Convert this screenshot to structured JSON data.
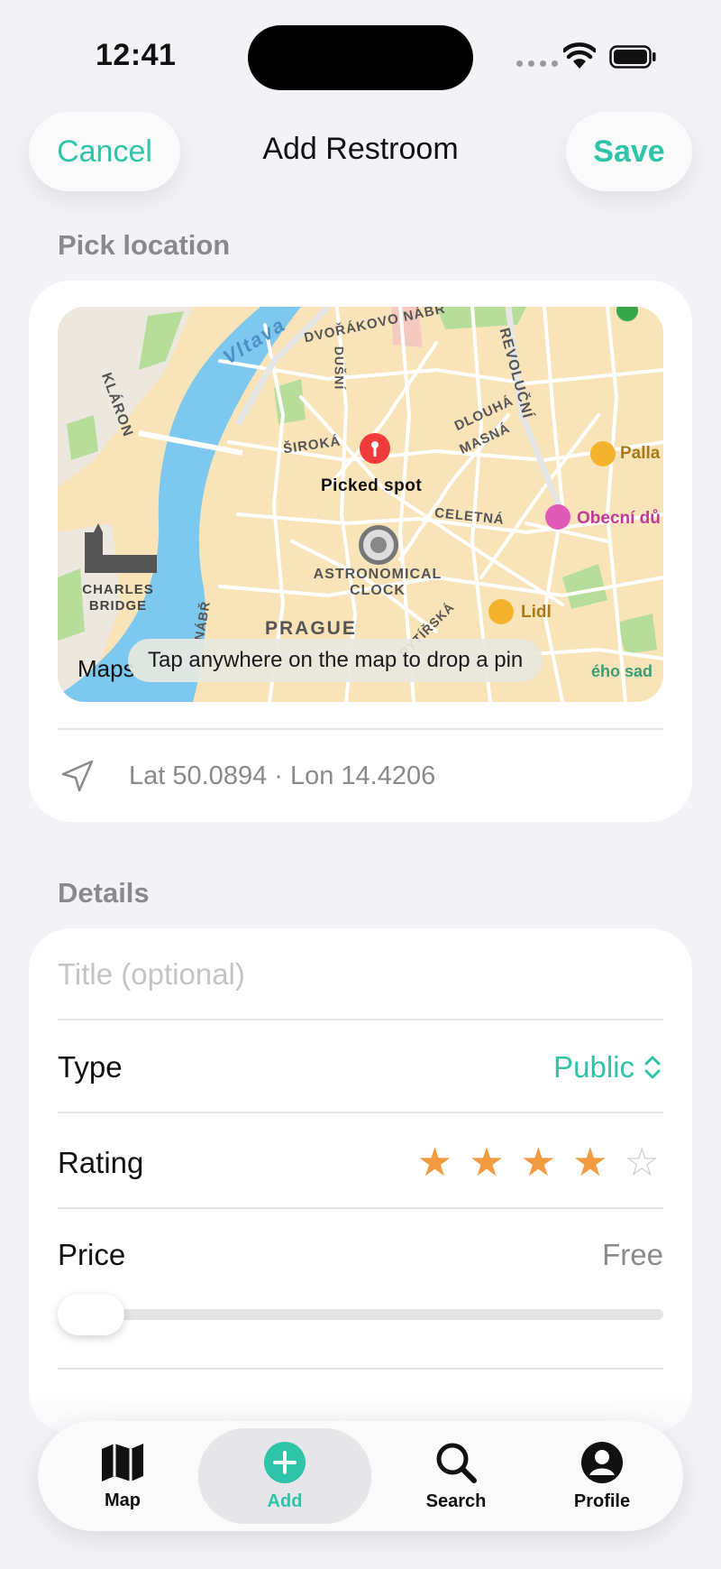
{
  "status": {
    "time": "12:41"
  },
  "nav": {
    "cancel": "Cancel",
    "title": "Add Restroom",
    "save": "Save"
  },
  "location": {
    "section_title": "Pick location",
    "map_labels": {
      "vltava": "Vltava",
      "dvorakovo": "DVOŘÁKOVO NÁBŘ",
      "klaron": "KLÁRON",
      "dusni": "DUŠNÍ",
      "revolucni": "REVOLUČNÍ",
      "dlouha": "DLOUHÁ",
      "masna": "MASNÁ",
      "siroka": "ŠIROKÁ",
      "celetna": "CELETNÁ",
      "astronomical_clock": "ASTRONOMICAL CLOCK",
      "charles_bridge": "CHARLES BRIDGE",
      "prague": "PRAGUE",
      "picked_spot": "Picked spot",
      "palla": "Palla",
      "obecni": "Obecní dů",
      "lidl": "Lidl",
      "kehosad": "ého sad",
      "nabr": "NÁBŘ",
      "rytirska": "RYTÍŘSKÁ",
      "maps_logo": "Maps"
    },
    "hint": "Tap anywhere on the map to drop a pin",
    "coords": "Lat 50.0894 · Lon 14.4206"
  },
  "details": {
    "section_title": "Details",
    "title_placeholder": "Title (optional)",
    "type_label": "Type",
    "type_value": "Public",
    "rating_label": "Rating",
    "rating_value": 4,
    "rating_max": 5,
    "price_label": "Price",
    "price_value": "Free",
    "price_slider_level": 0
  },
  "tabs": [
    {
      "label": "Map",
      "icon": "map-icon"
    },
    {
      "label": "Add",
      "icon": "add-icon"
    },
    {
      "label": "Search",
      "icon": "search-icon"
    },
    {
      "label": "Profile",
      "icon": "profile-icon"
    }
  ],
  "colors": {
    "accent": "#2ec4a8",
    "star": "#f19a3e",
    "pin": "#ef3b3b",
    "water": "#7cc8ee",
    "land": "#f8e4b8"
  }
}
